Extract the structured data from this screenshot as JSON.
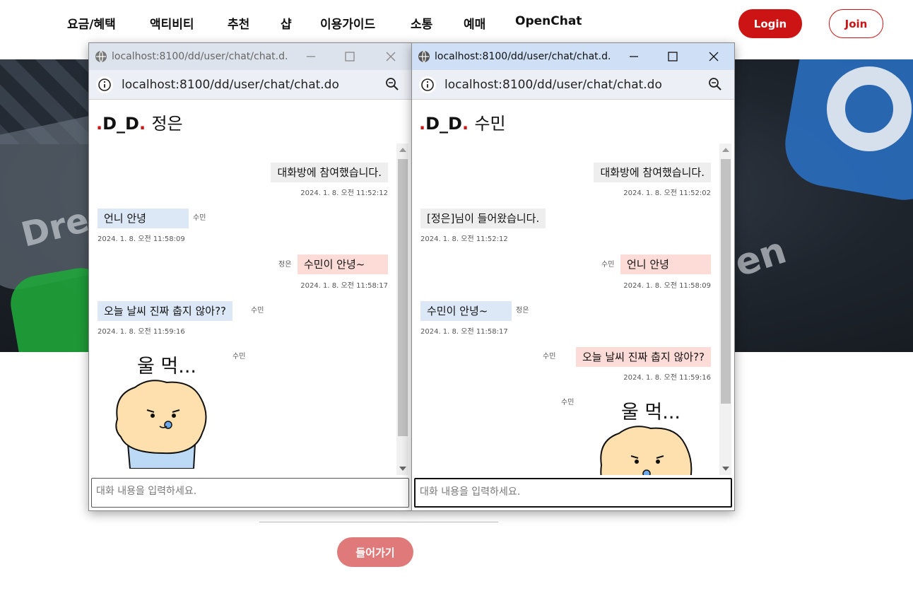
{
  "nav": {
    "items": [
      "요금/혜택",
      "액티비티",
      "추천",
      "샵",
      "이용가이드",
      "소통",
      "예매",
      "OpenChat"
    ],
    "login": "Login",
    "join": "Join"
  },
  "hero": {
    "words": [
      "Dre",
      "en"
    ]
  },
  "form": {
    "enter_button": "들어가기"
  },
  "colors": {
    "brand_red": "#cc1414",
    "enter_button": "#e07a7a",
    "bubble_mine": "#fddcd8",
    "bubble_other": "#dde8f7",
    "bubble_system": "#eeeeee"
  },
  "popup_left": {
    "window_title": "localhost:8100/dd/user/chat/chat.d...",
    "address": "localhost:8100/dd/user/chat/chat.do",
    "brand": "D_D",
    "room_user": "정은",
    "messages": [
      {
        "kind": "system",
        "text": "대화방에 참여했습니다.",
        "time": "2024. 1. 8. 오전 11:52:12"
      },
      {
        "kind": "other",
        "sender": "수민",
        "text": "언니 안녕",
        "time": "2024. 1. 8. 오전 11:58:09"
      },
      {
        "kind": "mine",
        "sender": "정은",
        "text": "수민이 안녕~",
        "time": "2024. 1. 8. 오전 11:58:17"
      },
      {
        "kind": "other",
        "sender": "수민",
        "text": "오늘 날씨 진짜 춥지 않아??",
        "time": "2024. 1. 8. 오전 11:59:16"
      },
      {
        "kind": "sticker",
        "sender": "수민",
        "caption": "울 먹..."
      }
    ],
    "input_placeholder": "대화 내용을 입력하세요."
  },
  "popup_right": {
    "window_title": "localhost:8100/dd/user/chat/chat.d...",
    "address": "localhost:8100/dd/user/chat/chat.do",
    "brand": "D_D",
    "room_user": "수민",
    "messages": [
      {
        "kind": "system",
        "text": "대화방에 참여했습니다.",
        "time": "2024. 1. 8. 오전 11:52:02"
      },
      {
        "kind": "system",
        "text": "[정은]님이 들어왔습니다.",
        "time": "2024. 1. 8. 오전 11:52:12"
      },
      {
        "kind": "mine",
        "sender": "수민",
        "text": "언니 안녕",
        "time": "2024. 1. 8. 오전 11:58:09"
      },
      {
        "kind": "other",
        "sender": "정은",
        "text": "수민이 안녕~",
        "time": "2024. 1. 8. 오전 11:58:17"
      },
      {
        "kind": "mine",
        "sender": "수민",
        "text": "오늘 날씨 진짜 춥지 않아??",
        "time": "2024. 1. 8. 오전 11:59:16"
      },
      {
        "kind": "sticker",
        "sender": "수민",
        "caption": "울 먹..."
      }
    ],
    "input_placeholder": "대화 내용을 입력하세요."
  },
  "icons": [
    "globe-icon",
    "minimize-icon",
    "maximize-icon",
    "close-icon",
    "info-icon",
    "zoom-icon"
  ]
}
